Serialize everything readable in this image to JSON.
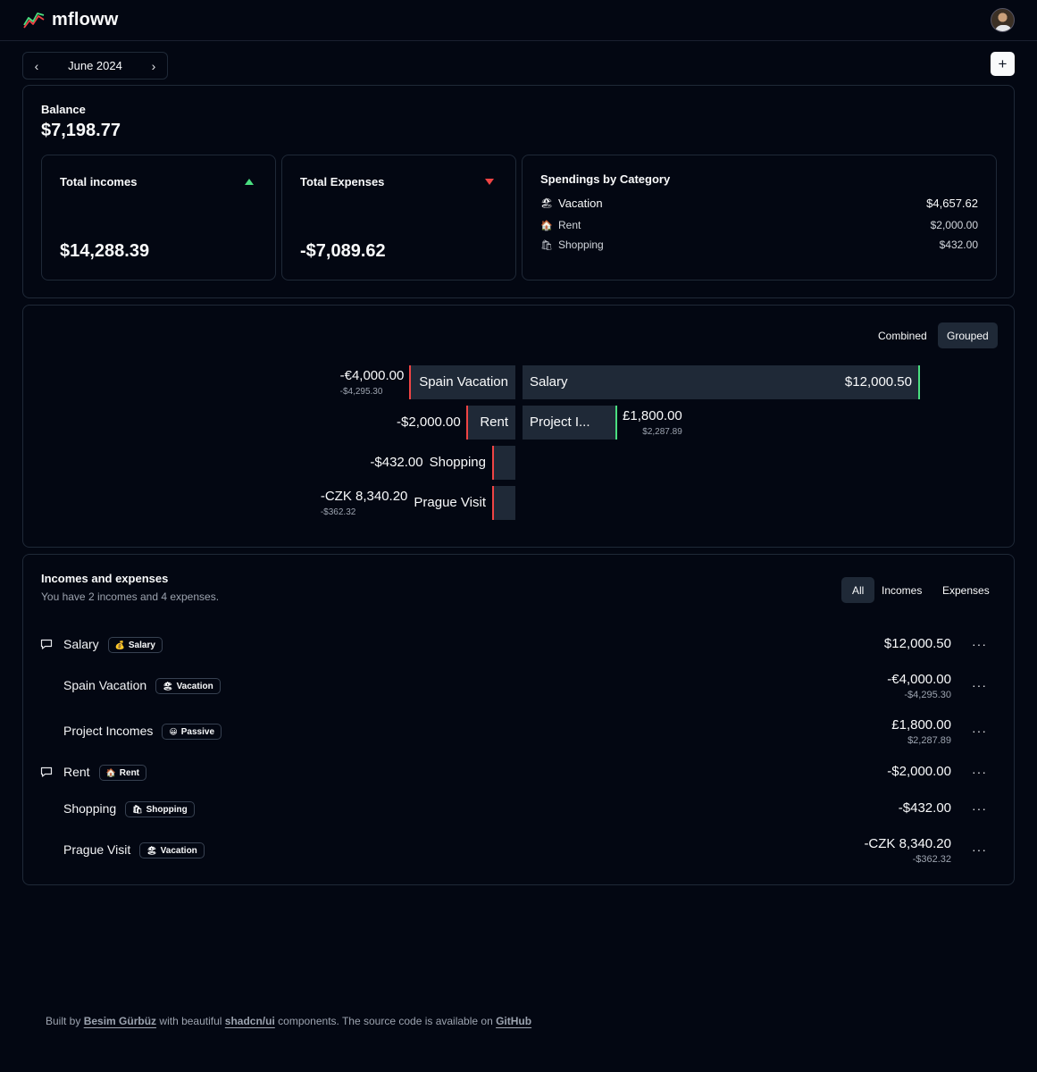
{
  "app": {
    "name": "mfloww",
    "logo_icon": "trend-line-icon"
  },
  "header": {
    "month": "June 2024",
    "prev_icon": "chevron-left-icon",
    "next_icon": "chevron-right-icon",
    "add_icon": "plus-icon"
  },
  "balance": {
    "label": "Balance",
    "value": "$7,198.77",
    "incomes": {
      "title": "Total incomes",
      "value": "$14,288.39",
      "trend": "up"
    },
    "expenses": {
      "title": "Total Expenses",
      "value": "-$7,089.62",
      "trend": "down"
    },
    "categories": {
      "title": "Spendings by Category",
      "items": [
        {
          "emoji": "🏖",
          "name": "Vacation",
          "amount": "$4,657.62"
        },
        {
          "emoji": "🏠",
          "name": "Rent",
          "amount": "$2,000.00"
        },
        {
          "emoji": "🛍",
          "name": "Shopping",
          "amount": "$432.00"
        }
      ]
    }
  },
  "chart": {
    "toggles": [
      "Combined",
      "Grouped"
    ],
    "active_toggle": "Grouped",
    "colors": {
      "expense": "#ef4444",
      "income": "#4ade80",
      "bar": "#1f2937"
    }
  },
  "chart_data": {
    "type": "bar",
    "orientation": "horizontal-diverging",
    "expenses": [
      {
        "name": "Spain Vacation",
        "value": -4295.3,
        "label": "-€4,000.00",
        "sublabel": "-$4,295.30"
      },
      {
        "name": "Rent",
        "value": -2000.0,
        "label": "-$2,000.00",
        "sublabel": ""
      },
      {
        "name": "Shopping",
        "value": -432.0,
        "label": "-$432.00",
        "sublabel": ""
      },
      {
        "name": "Prague Visit",
        "value": -362.32,
        "label": "-CZK 8,340.20",
        "sublabel": "-$362.32"
      }
    ],
    "incomes": [
      {
        "name": "Salary",
        "value": 12000.5,
        "label": "$12,000.50",
        "sublabel": ""
      },
      {
        "name": "Project I...",
        "value": 2287.89,
        "label": "£1,800.00",
        "sublabel": "$2,287.89"
      }
    ]
  },
  "list": {
    "title": "Incomes and expenses",
    "subtitle": "You have 2 incomes and 4 expenses.",
    "filters": [
      "All",
      "Incomes",
      "Expenses"
    ],
    "active_filter": "All",
    "rows": [
      {
        "name": "Salary",
        "recurring": true,
        "badge_emoji": "💰",
        "badge": "Salary",
        "amount": "$12,000.50",
        "sub": ""
      },
      {
        "name": "Spain Vacation",
        "recurring": false,
        "badge_emoji": "🏖",
        "badge": "Vacation",
        "amount": "-€4,000.00",
        "sub": "-$4,295.30"
      },
      {
        "name": "Project Incomes",
        "recurring": false,
        "badge_emoji": "😀",
        "badge": "Passive",
        "amount": "£1,800.00",
        "sub": "$2,287.89"
      },
      {
        "name": "Rent",
        "recurring": true,
        "badge_emoji": "🏠",
        "badge": "Rent",
        "amount": "-$2,000.00",
        "sub": ""
      },
      {
        "name": "Shopping",
        "recurring": false,
        "badge_emoji": "🛍",
        "badge": "Shopping",
        "amount": "-$432.00",
        "sub": ""
      },
      {
        "name": "Prague Visit",
        "recurring": false,
        "badge_emoji": "🏖",
        "badge": "Vacation",
        "amount": "-CZK 8,340.20",
        "sub": "-$362.32"
      }
    ],
    "more_label": "···"
  },
  "footer": {
    "prefix": "Built by",
    "author": "Besim Gürbüz",
    "middle": "with beautiful",
    "lib": "shadcn/ui",
    "suffix": "components. The source code is available on",
    "repo": "GitHub"
  }
}
